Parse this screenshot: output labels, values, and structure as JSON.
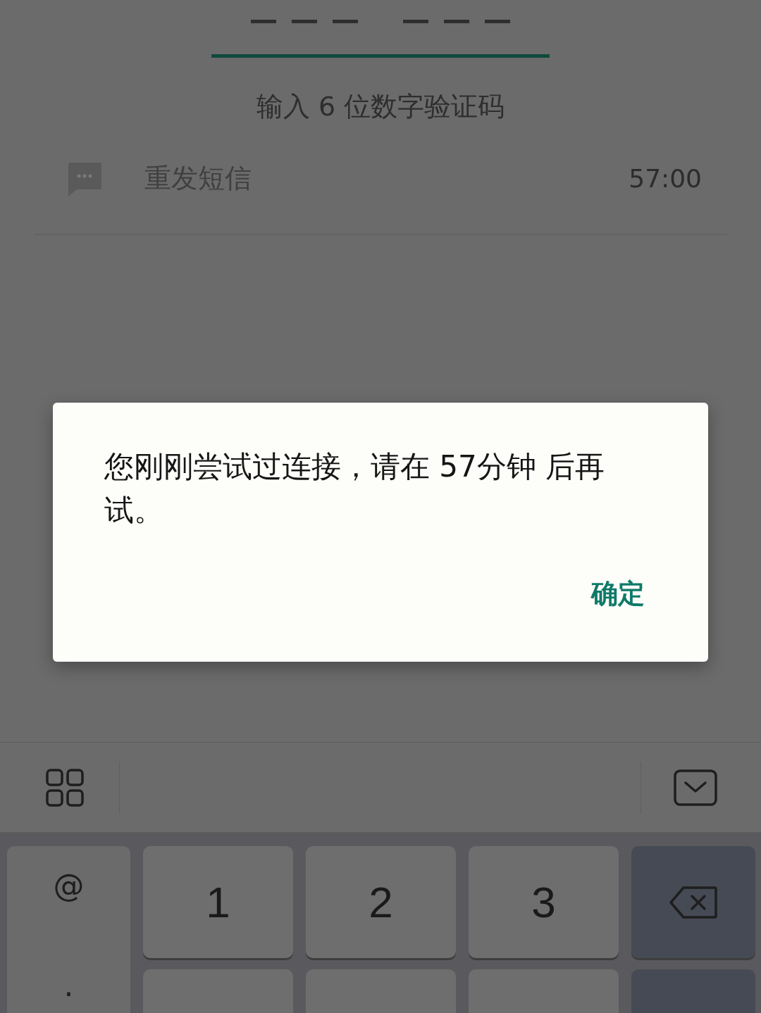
{
  "code_field": {
    "focused": true
  },
  "instruction": "输入 6 位数字验证码",
  "resend": {
    "label": "重发短信",
    "timer": "57:00",
    "disabled": true
  },
  "dialog": {
    "message": "您刚刚尝试过连接，请在 57分钟 后再试。",
    "buttons": [
      {
        "label": "确定"
      }
    ]
  },
  "keyboard": {
    "side_keys": [
      "@",
      "."
    ],
    "rows": [
      [
        {
          "kind": "digit",
          "label": "1"
        },
        {
          "kind": "digit",
          "label": "2"
        },
        {
          "kind": "digit",
          "label": "3"
        },
        {
          "kind": "backspace"
        }
      ],
      [
        {
          "kind": "digit_cut"
        },
        {
          "kind": "digit_cut"
        },
        {
          "kind": "digit_cut"
        },
        {
          "kind": "action_cut"
        }
      ]
    ]
  }
}
